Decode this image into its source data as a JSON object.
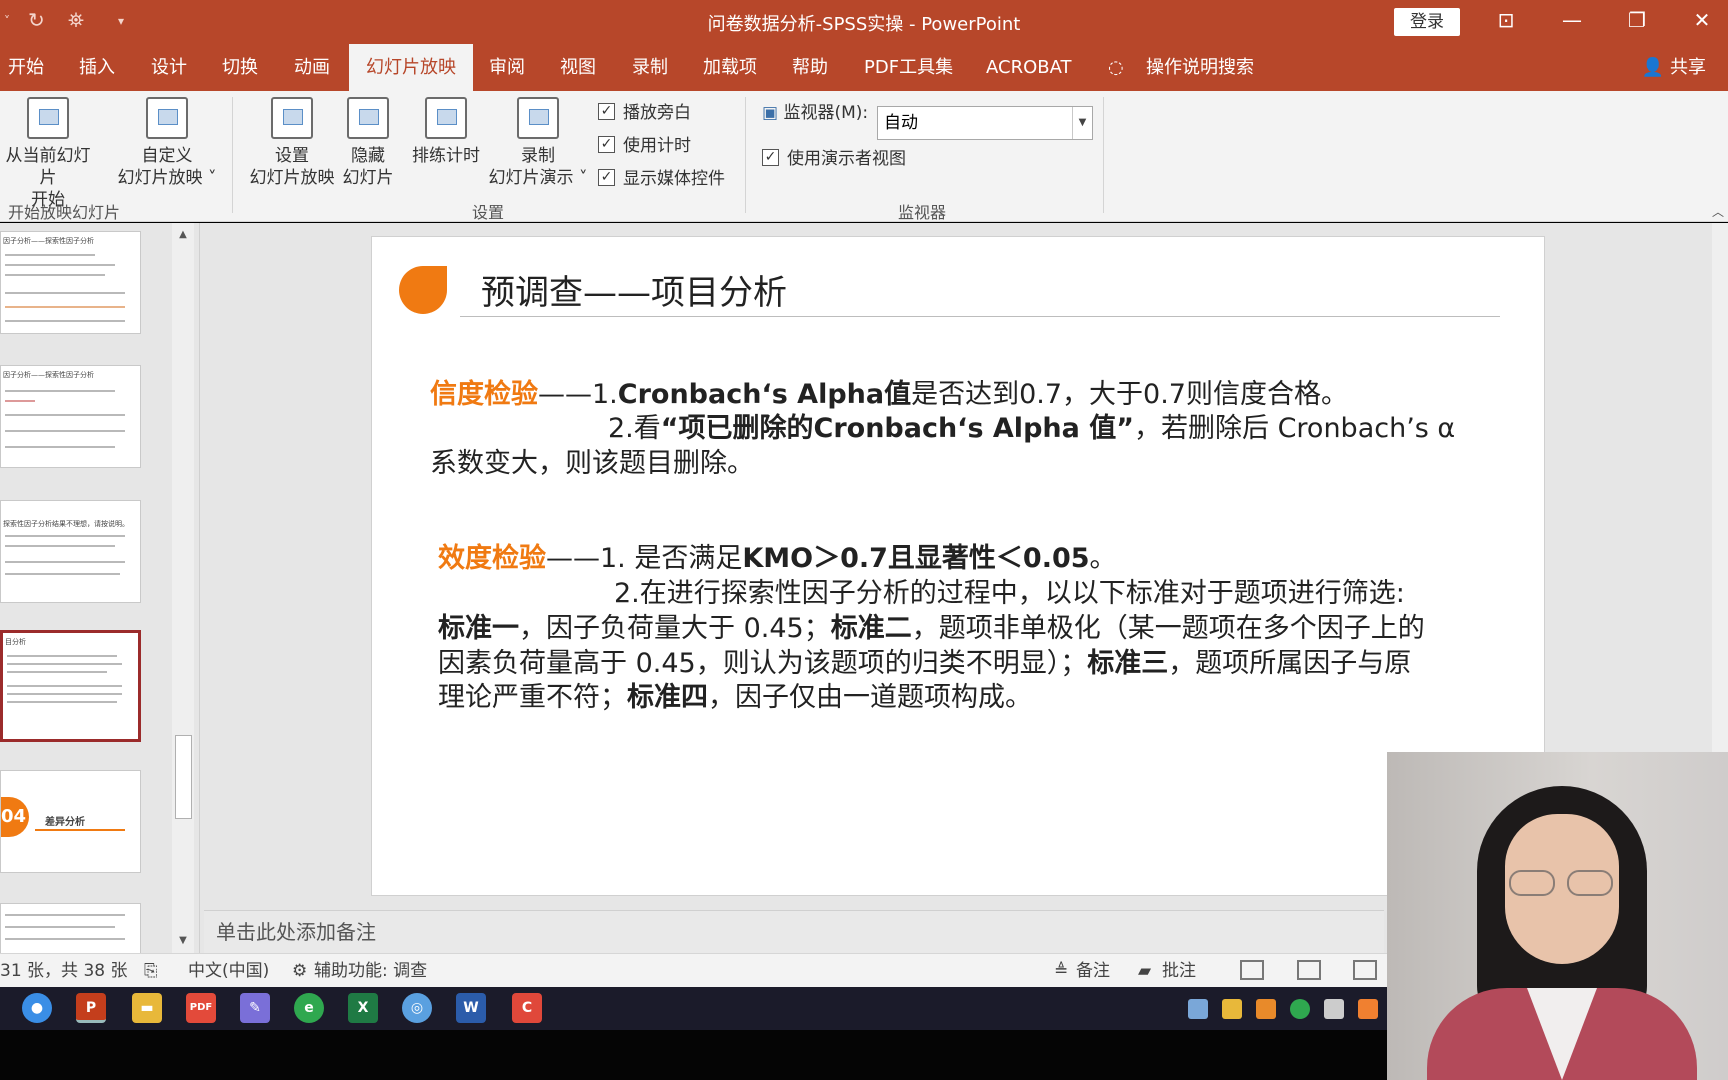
{
  "window": {
    "title": "问卷数据分析-SPSS实操 - PowerPoint",
    "login": "登录"
  },
  "tabs": [
    "开始",
    "插入",
    "设计",
    "切换",
    "动画",
    "幻灯片放映",
    "审阅",
    "视图",
    "录制",
    "加载项",
    "帮助",
    "PDF工具集",
    "ACROBAT"
  ],
  "active_tab": "幻灯片放映",
  "tell_me": "操作说明搜索",
  "share": "共享",
  "ribbon": {
    "from_current_1": "从当前幻灯片",
    "from_current_2": "开始",
    "custom_1": "自定义",
    "custom_2": "幻灯片放映 ˅",
    "group_start": "开始放映幻灯片",
    "setup_1": "设置",
    "setup_2": "幻灯片放映",
    "hide_1": "隐藏",
    "hide_2": "幻灯片",
    "rehearse": "排练计时",
    "record_1": "录制",
    "record_2": "幻灯片演示 ˅",
    "chk_narration": "播放旁白",
    "chk_timing": "使用计时",
    "chk_media": "显示媒体控件",
    "group_setup": "设置",
    "monitor_label": "监视器(M):",
    "monitor_value": "自动",
    "presenter_view": "使用演示者视图",
    "group_monitor": "监视器"
  },
  "thumbs": {
    "t1": "因子分析——探索性因子分析",
    "t2": "因子分析——探索性因子分析",
    "t3": "探索性因子分析结果不理想，请按说明。",
    "t4": "目分析",
    "t5_num": "04",
    "t5_title": "差异分析"
  },
  "slide": {
    "title": "预调查——项目分析",
    "rel_label": "信度检验",
    "rel_dash": "——1.",
    "rel_1_bold": "Cronbach‘s Alpha值",
    "rel_1_rest": "是否达到0.7，大于0.7则信度合格。",
    "rel_2_pre": "2.看",
    "rel_2_bold": "“项已删除的Cronbach‘s Alpha 值”",
    "rel_2_rest": "，若删除后 Cronbach’s α",
    "rel_3": "系数变大，则该题目删除。",
    "val_label": "效度检验",
    "val_dash": "——1. 是否满足",
    "val_1_bold": "KMO＞0.7且显著性＜0.05",
    "val_1_end": "。",
    "val_2": "2.在进行探索性因子分析的过程中，以以下标准对于题项进行筛选:",
    "std1": "标准一",
    "std1_text": "，因子负荷量大于 0.45；",
    "std2": "标准二",
    "std2_text": "，题项非单极化（某一题项在多个因子上的",
    "line5": "因素负荷量高于 0.45，则认为该题项的归类不明显）；",
    "std3": "标准三",
    "std3_text": "，题项所属因子与原",
    "line6_pre": "理论严重不符；",
    "std4": "标准四",
    "std4_text": "，因子仅由一道题项构成。"
  },
  "notes_placeholder": "单击此处添加备注",
  "status": {
    "slide_count": "31 张，共 38 张",
    "language": "中文(中国)",
    "accessibility": "辅助功能: 调查",
    "notes": "备注",
    "comments": "批注"
  },
  "taskbar": {
    "pdf": "PDF",
    "excel": "X",
    "word": "W",
    "ppt": "P"
  },
  "colors": {
    "accent": "#b7472a",
    "orange": "#f07a12"
  }
}
